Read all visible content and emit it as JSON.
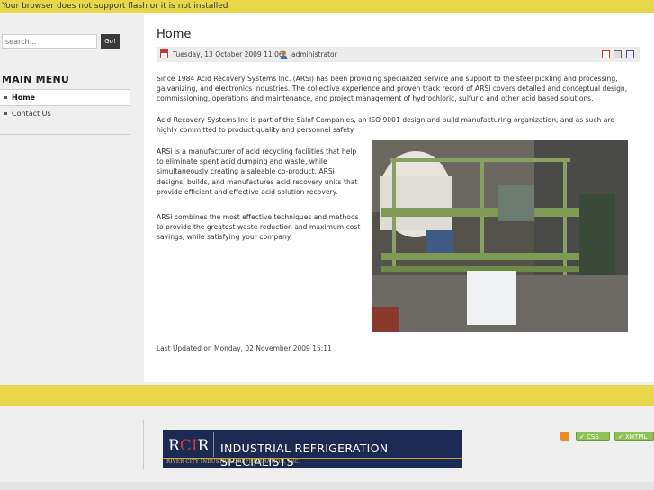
{
  "notice": "Your browser does not support flash or it is not installed",
  "search": {
    "placeholder": "search...",
    "button": "Go!"
  },
  "menu": {
    "title": "MAIN MENU",
    "items": [
      {
        "label": "Home"
      },
      {
        "label": "Contact Us"
      }
    ]
  },
  "article": {
    "title": "Home",
    "date": "Tuesday, 13 October 2009 11:06",
    "author": "administrator",
    "para1": "Since 1984 Acid Recovery Systems Inc. (ARSi) has been providing specialized service and support to the steel pickling and processing, galvanizing, and electronics industries. The collective experience and proven track record of ARSi covers detailed and conceptual design, commissioning, operations and maintenance, and project management of hydrochloric, sulfuric and other acid based solutions.",
    "para2": "Acid Recovery Systems Inc is part of the Salof Companies, an ISO 9001 design and build manufacturing organization, and as such are highly committed to product quality and personnel safety.",
    "para3": "ARSi is a manufacturer of acid recycling facilities that help to eliminate spent acid dumping and waste, while simultaneously creating a saleable co-product. ARSi designs, builds, and manufactures acid recovery units that provide efficient and effective acid solution recovery.",
    "para4": "ARSi combines the most effective techniques and methods to provide the greatest waste reduction and maximum cost savings, while satisfying your company",
    "updated": "Last Updated on Monday, 02 November 2009 15:11"
  },
  "banner": {
    "logo_r": "R",
    "logo_ci": "CI",
    "logo_r2": "R",
    "title": "INDUSTRIAL REFRIGERATION SPECIALISTS",
    "subtitle": "RIVER CITY INDUSTRIAL REFRIGERATION, INC."
  },
  "badges": {
    "css": "CSS",
    "xhtml": "XHTML"
  },
  "colors": {
    "accent": "#e8d74a",
    "badge": "#8fc35a",
    "banner": "#1b2a52"
  },
  "icons": [
    "calendar-icon",
    "user-icon",
    "pdf-icon",
    "print-icon",
    "email-icon",
    "rss-icon",
    "check-icon"
  ]
}
